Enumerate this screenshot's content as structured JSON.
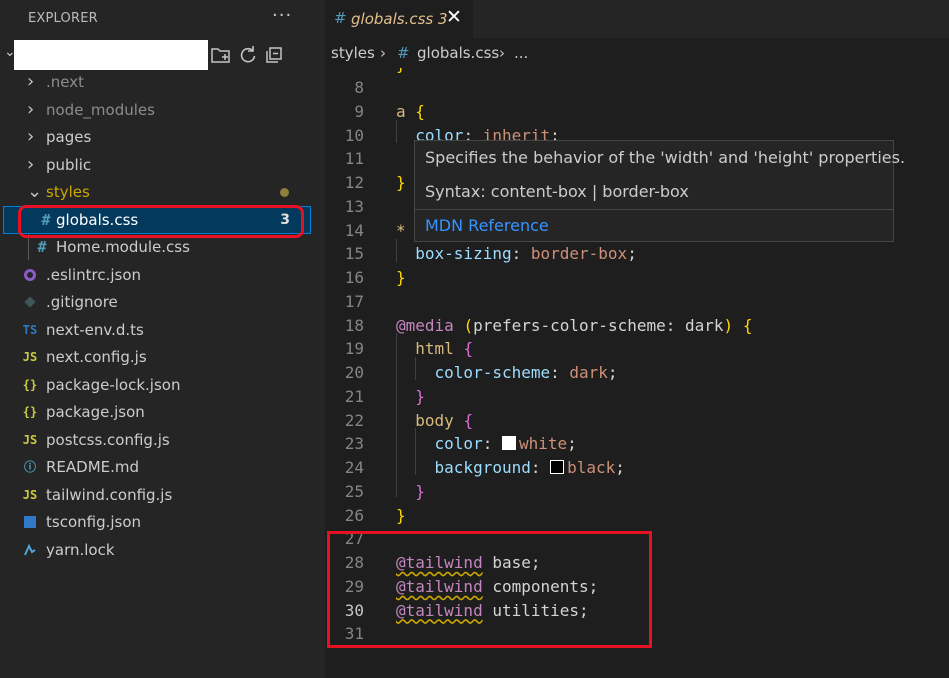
{
  "sidebar": {
    "title": "EXPLORER",
    "more_label": "···",
    "items": [
      {
        "label": ".next",
        "kind": "folder",
        "dim": true
      },
      {
        "label": "node_modules",
        "kind": "folder",
        "dim": true
      },
      {
        "label": "pages",
        "kind": "folder"
      },
      {
        "label": "public",
        "kind": "folder"
      },
      {
        "label": "styles",
        "kind": "folder-open",
        "modified": true
      },
      {
        "label": "globals.css",
        "kind": "css",
        "badge": "3",
        "selected": true
      },
      {
        "label": "Home.module.css",
        "kind": "css"
      },
      {
        "label": ".eslintrc.json",
        "kind": "eslint"
      },
      {
        "label": ".gitignore",
        "kind": "git"
      },
      {
        "label": "next-env.d.ts",
        "kind": "ts",
        "icon_text": "TS"
      },
      {
        "label": "next.config.js",
        "kind": "js",
        "icon_text": "JS"
      },
      {
        "label": "package-lock.json",
        "kind": "json",
        "icon_text": "{}"
      },
      {
        "label": "package.json",
        "kind": "json",
        "icon_text": "{}"
      },
      {
        "label": "postcss.config.js",
        "kind": "js",
        "icon_text": "JS"
      },
      {
        "label": "README.md",
        "kind": "info",
        "icon_text": "ⓘ"
      },
      {
        "label": "tailwind.config.js",
        "kind": "js",
        "icon_text": "JS"
      },
      {
        "label": "tsconfig.json",
        "kind": "tsconfig",
        "icon_text": "TS"
      },
      {
        "label": "yarn.lock",
        "kind": "yarn"
      }
    ]
  },
  "tab": {
    "hash": "#",
    "label": "globals.css 3",
    "close": "✕"
  },
  "breadcrumb": {
    "folder": "styles",
    "sep1": "›",
    "hash": "#",
    "file": "globals.css",
    "sep2": "›",
    "more": "..."
  },
  "hover": {
    "description": "Specifies the behavior of the 'width' and 'height' properties.",
    "syntax": "Syntax: content-box | border-box",
    "link": "MDN Reference"
  },
  "editor": {
    "active_line": 30,
    "lines": [
      {
        "n": "8",
        "tokens": []
      },
      {
        "n": "9",
        "tokens": [
          [
            "sel",
            "a"
          ],
          [
            "ident",
            " "
          ],
          [
            "br-y",
            "{"
          ]
        ]
      },
      {
        "n": "10",
        "tokens": [
          [
            "ident",
            "  "
          ],
          [
            "prop",
            "color"
          ],
          [
            "ident",
            ": "
          ],
          [
            "val",
            "inherit"
          ],
          [
            "ident",
            ";"
          ]
        ]
      },
      {
        "n": "11",
        "tokens": []
      },
      {
        "n": "12",
        "tokens": [
          [
            "br-y",
            "}"
          ]
        ]
      },
      {
        "n": "13",
        "tokens": []
      },
      {
        "n": "14",
        "tokens": [
          [
            "sel",
            "*"
          ]
        ]
      },
      {
        "n": "15",
        "tokens": [
          [
            "ident",
            "  "
          ],
          [
            "prop",
            "box-sizing"
          ],
          [
            "ident",
            ": "
          ],
          [
            "val",
            "border-box"
          ],
          [
            "ident",
            ";"
          ]
        ]
      },
      {
        "n": "16",
        "tokens": [
          [
            "br-y",
            "}"
          ]
        ]
      },
      {
        "n": "17",
        "tokens": []
      },
      {
        "n": "18",
        "tokens": [
          [
            "at",
            "@media"
          ],
          [
            "ident",
            " "
          ],
          [
            "br-y",
            "("
          ],
          [
            "ident",
            "prefers-color-scheme"
          ],
          [
            "ident",
            ": dark"
          ],
          [
            "br-y",
            ")"
          ],
          [
            "ident",
            " "
          ],
          [
            "br-y",
            "{"
          ]
        ]
      },
      {
        "n": "19",
        "tokens": [
          [
            "ident",
            "  "
          ],
          [
            "sel",
            "html"
          ],
          [
            "ident",
            " "
          ],
          [
            "br-p",
            "{"
          ]
        ]
      },
      {
        "n": "20",
        "tokens": [
          [
            "ident",
            "    "
          ],
          [
            "prop",
            "color-scheme"
          ],
          [
            "ident",
            ": "
          ],
          [
            "val",
            "dark"
          ],
          [
            "ident",
            ";"
          ]
        ]
      },
      {
        "n": "21",
        "tokens": [
          [
            "ident",
            "  "
          ],
          [
            "br-p",
            "}"
          ]
        ]
      },
      {
        "n": "22",
        "tokens": [
          [
            "ident",
            "  "
          ],
          [
            "sel",
            "body"
          ],
          [
            "ident",
            " "
          ],
          [
            "br-p",
            "{"
          ]
        ]
      },
      {
        "n": "23",
        "tokens": [
          [
            "ident",
            "    "
          ],
          [
            "prop",
            "color"
          ],
          [
            "ident",
            ": "
          ],
          [
            "swatch-white",
            ""
          ],
          [
            "val",
            "white"
          ],
          [
            "ident",
            ";"
          ]
        ]
      },
      {
        "n": "24",
        "tokens": [
          [
            "ident",
            "    "
          ],
          [
            "prop",
            "background"
          ],
          [
            "ident",
            ": "
          ],
          [
            "swatch-black",
            ""
          ],
          [
            "val",
            "black"
          ],
          [
            "ident",
            ";"
          ]
        ]
      },
      {
        "n": "25",
        "tokens": [
          [
            "ident",
            "  "
          ],
          [
            "br-p",
            "}"
          ]
        ]
      },
      {
        "n": "26",
        "tokens": [
          [
            "br-y",
            "}"
          ]
        ]
      },
      {
        "n": "27",
        "tokens": []
      },
      {
        "n": "28",
        "tokens": [
          [
            "at squig",
            "@tailwind"
          ],
          [
            "ident",
            " base;"
          ]
        ]
      },
      {
        "n": "29",
        "tokens": [
          [
            "at squig",
            "@tailwind"
          ],
          [
            "ident",
            " components;"
          ]
        ]
      },
      {
        "n": "30",
        "tokens": [
          [
            "at squig",
            "@tailwind"
          ],
          [
            "ident",
            " utilities;"
          ]
        ]
      },
      {
        "n": "31",
        "tokens": []
      }
    ]
  },
  "colors": {
    "accent": "#007fd4",
    "highlight_red": "#e81123",
    "modified_yellow": "#cca700"
  }
}
